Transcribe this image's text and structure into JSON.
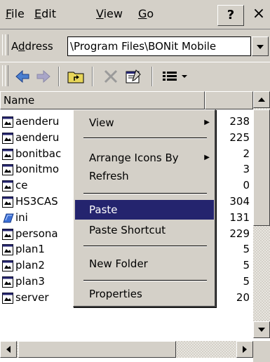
{
  "menubar": {
    "items": [
      {
        "mnemonic": "F",
        "rest": "ile"
      },
      {
        "mnemonic": "E",
        "rest": "dit"
      },
      {
        "mnemonic": "V",
        "rest": "iew"
      },
      {
        "mnemonic": "G",
        "rest": "o"
      }
    ],
    "help_label": "?",
    "close_label": "×"
  },
  "address": {
    "label_pre": "A",
    "label_mn": "d",
    "label_post": "dress",
    "value": "\\Program Files\\BONit Mobile"
  },
  "list": {
    "header_name": "Name",
    "files": [
      {
        "name": "aenderu",
        "size": "238",
        "icon": "file-icon"
      },
      {
        "name": "aenderu",
        "size": "225",
        "icon": "file-icon"
      },
      {
        "name": "bonitbac",
        "size": "2",
        "icon": "file-icon"
      },
      {
        "name": "bonitmo",
        "size": "3",
        "icon": "file-icon"
      },
      {
        "name": "ce",
        "size": "0",
        "icon": "file-icon"
      },
      {
        "name": "HS3CAS",
        "size": "304",
        "icon": "file-icon"
      },
      {
        "name": "ini",
        "size": "131",
        "icon": "ini-file-icon"
      },
      {
        "name": "persona",
        "size": "229",
        "icon": "file-icon"
      },
      {
        "name": "plan1",
        "size": "5",
        "icon": "file-icon"
      },
      {
        "name": "plan2",
        "size": "5",
        "icon": "file-icon"
      },
      {
        "name": "plan3",
        "size": "5",
        "icon": "file-icon"
      },
      {
        "name": "server",
        "size": "20",
        "icon": "file-icon"
      }
    ]
  },
  "context_menu": {
    "items": [
      {
        "label": "View",
        "submenu": true
      },
      {
        "label": "Arrange Icons By",
        "submenu": true
      },
      {
        "label": "Refresh",
        "submenu": false
      },
      {
        "label": "Paste",
        "submenu": false,
        "selected": true
      },
      {
        "label": "Paste Shortcut",
        "submenu": false
      },
      {
        "label": "New Folder",
        "submenu": false
      },
      {
        "label": "Properties",
        "submenu": false
      }
    ]
  },
  "colors": {
    "face": "#d4d0c8",
    "selection": "#24246e",
    "list_bg": "#ffffff"
  }
}
